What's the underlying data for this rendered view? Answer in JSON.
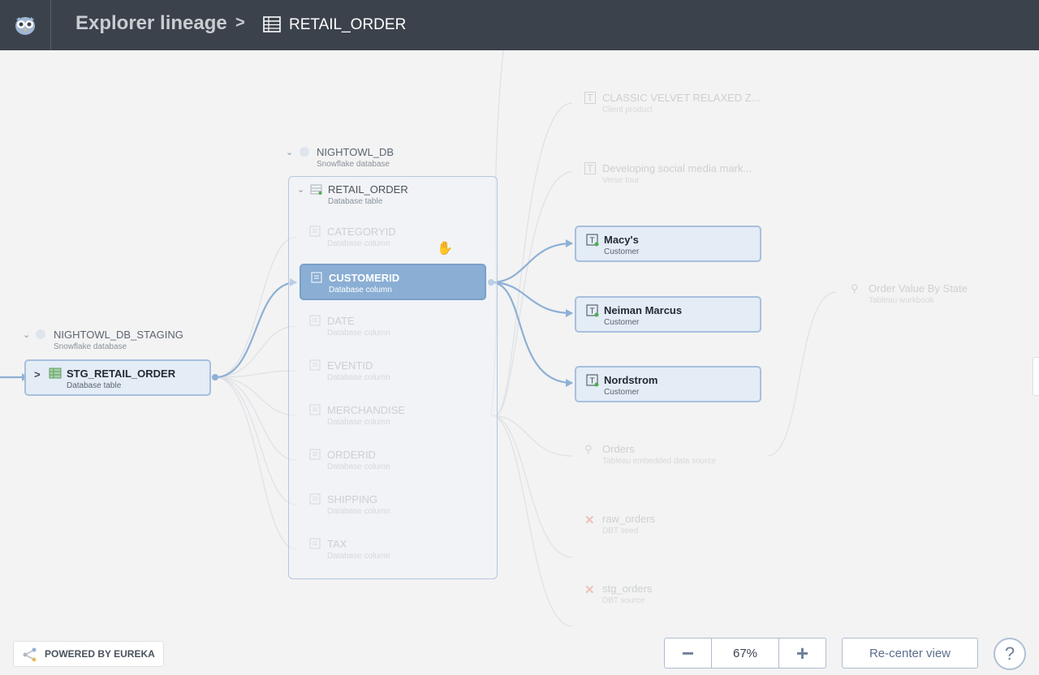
{
  "header": {
    "title": "Explorer lineage",
    "breadcrumb_separator": ">",
    "breadcrumb_current": "RETAIL_ORDER",
    "logo_icon": "owl-logo-icon",
    "table_icon": "table-icon"
  },
  "groups": {
    "staging": {
      "name": "NIGHTOWL_DB_STAGING",
      "sub": "Snowflake database"
    },
    "main": {
      "name": "NIGHTOWL_DB",
      "sub": "Snowflake database"
    }
  },
  "nodes": {
    "stg_retail_order": {
      "name": "STG_RETAIL_ORDER",
      "sub": "Database table"
    },
    "retail_order": {
      "name": "RETAIL_ORDER",
      "sub": "Database table"
    },
    "columns": [
      {
        "name": "CATEGORYID",
        "sub": "Database column",
        "selected": false
      },
      {
        "name": "CUSTOMERID",
        "sub": "Database column",
        "selected": true
      },
      {
        "name": "DATE",
        "sub": "Database column",
        "selected": false
      },
      {
        "name": "EVENTID",
        "sub": "Database column",
        "selected": false
      },
      {
        "name": "MERCHANDISE",
        "sub": "Database column",
        "selected": false
      },
      {
        "name": "ORDERID",
        "sub": "Database column",
        "selected": false
      },
      {
        "name": "SHIPPING",
        "sub": "Database column",
        "selected": false
      },
      {
        "name": "TAX",
        "sub": "Database column",
        "selected": false
      }
    ],
    "customers": [
      {
        "name": "Macy's",
        "sub": "Customer"
      },
      {
        "name": "Neiman Marcus",
        "sub": "Customer"
      },
      {
        "name": "Nordstrom",
        "sub": "Customer"
      }
    ],
    "faded_right": [
      {
        "name": "CLASSIC VELVET RELAXED Z...",
        "sub": "Client product"
      },
      {
        "name": "Developing social media mark...",
        "sub": "Verse tour"
      },
      {
        "name": "Orders",
        "sub": "Tableau embedded data source"
      },
      {
        "name": "raw_orders",
        "sub": "DBT seed"
      },
      {
        "name": "stg_orders",
        "sub": "DBT source"
      }
    ],
    "far_right": {
      "name": "Order Value By State",
      "sub": "Tableau workbook"
    }
  },
  "footer": {
    "powered_by": "POWERED BY EUREKA",
    "zoom_minus": "−",
    "zoom_value": "67%",
    "zoom_plus": "+",
    "recenter": "Re-center view",
    "help": "?"
  },
  "colors": {
    "header_bg": "#3c424b",
    "canvas_bg": "#f3f3f3",
    "edge_active": "#8eb0d6",
    "node_selected": "#8aaed4",
    "node_active_bg": "#e4ecf6",
    "status_green": "#4caf50"
  }
}
